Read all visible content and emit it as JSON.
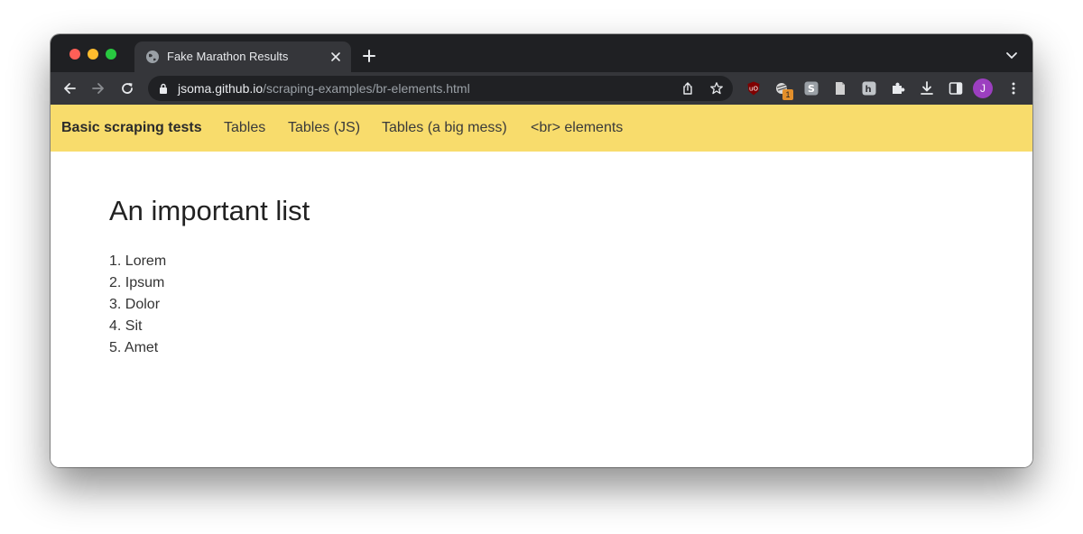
{
  "browser": {
    "tab": {
      "title": "Fake Marathon Results"
    },
    "address": {
      "host": "jsoma.github.io",
      "path": "/scraping-examples/br-elements.html"
    },
    "profile_initial": "J",
    "extension_badge": "1",
    "colors": {
      "tabstrip": "#1f2023",
      "toolbar": "#35363a",
      "avatar": "#9c3fc0"
    }
  },
  "nav": {
    "brand": "Basic scraping tests",
    "links": [
      "Tables",
      "Tables (JS)",
      "Tables (a big mess)",
      "<br> elements"
    ]
  },
  "main": {
    "heading": "An important list",
    "items": [
      "1. Lorem",
      "2. Ipsum",
      "3. Dolor",
      "4. Sit",
      "5. Amet"
    ]
  },
  "colors": {
    "navbar": "#f8dc6c"
  }
}
